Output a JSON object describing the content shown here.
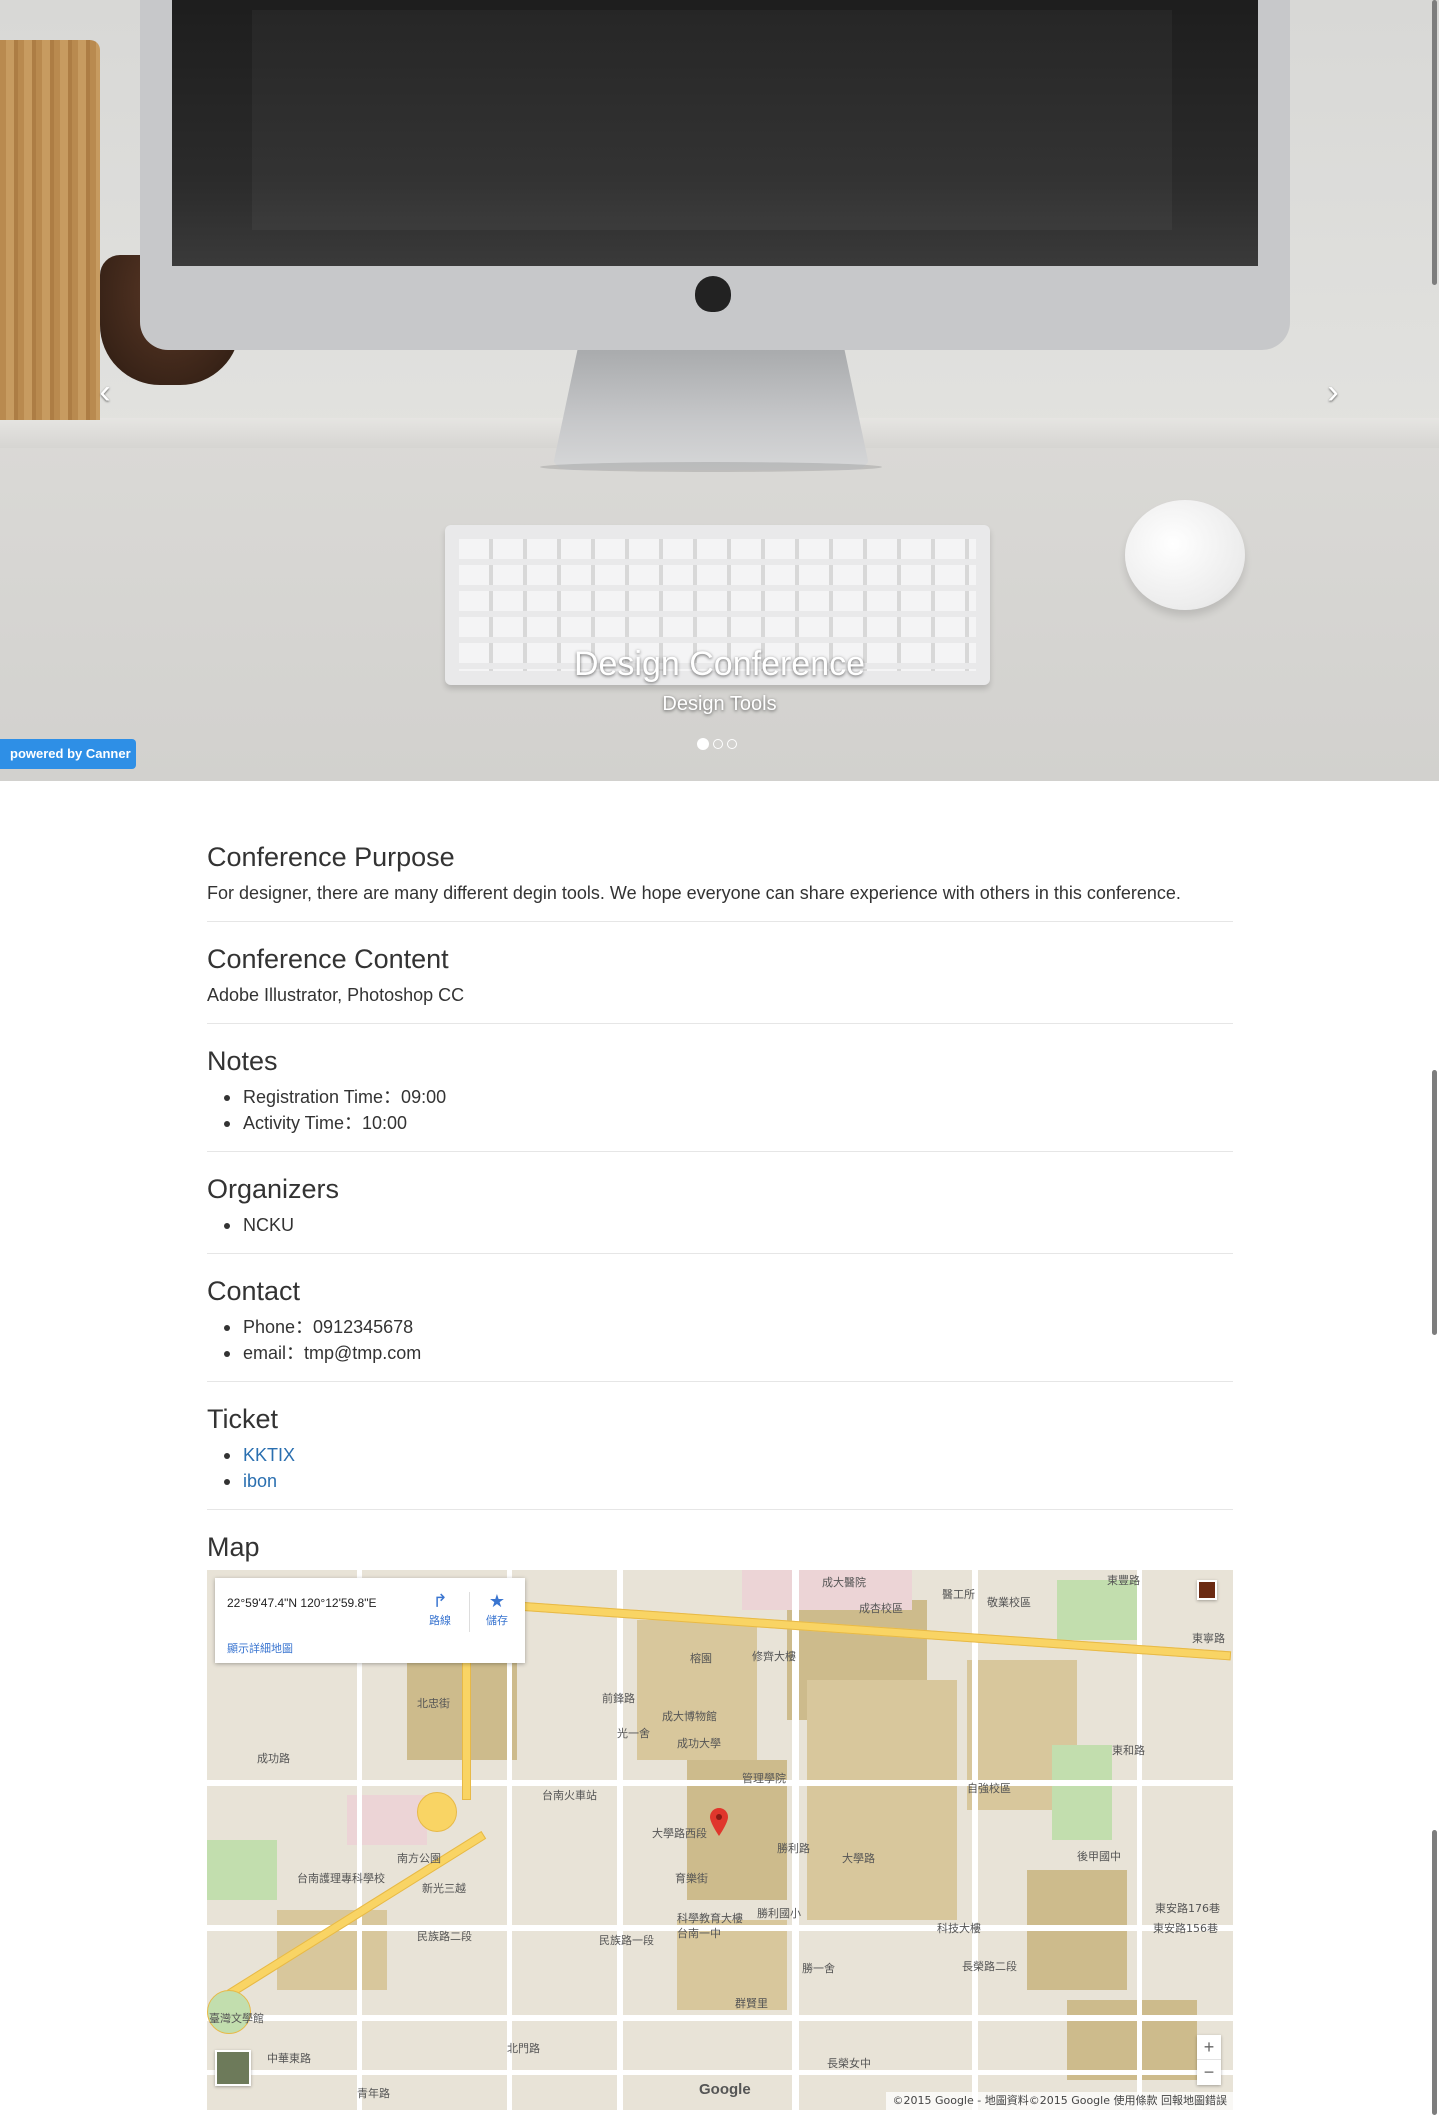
{
  "hero": {
    "title": "Design Conference",
    "subtitle": "Design Tools",
    "prev_icon": "chevron-left-icon",
    "next_icon": "chevron-right-icon",
    "prev_glyph": "‹",
    "next_glyph": "›",
    "slides": 3,
    "active_slide": 1
  },
  "badge": {
    "label": "powered by Canner",
    "color": "#2e8fe6"
  },
  "sections": {
    "purpose": {
      "title": "Conference Purpose",
      "text": "For designer, there are many different degin tools. We hope everyone can share experience with others in this conference."
    },
    "content": {
      "title": "Conference Content",
      "text": "Adobe Illustrator, Photoshop CC"
    },
    "notes": {
      "title": "Notes",
      "items": [
        "Registration Time：09:00",
        "Activity Time：10:00"
      ]
    },
    "organizers": {
      "title": "Organizers",
      "items": [
        "NCKU"
      ]
    },
    "contact": {
      "title": "Contact",
      "items": [
        "Phone：0912345678",
        "email：tmp@tmp.com"
      ]
    },
    "ticket": {
      "title": "Ticket",
      "links": [
        "KKTIX",
        "ibon"
      ],
      "link_color": "#2a6fb0"
    },
    "map": {
      "title": "Map"
    }
  },
  "map": {
    "coords": "22°59'47.4\"N 120°12'59.8\"E",
    "larger_map_link": "顯示詳細地圖",
    "directions_label": "路線",
    "save_label": "儲存",
    "zoom_in": "+",
    "zoom_out": "−",
    "google_logo": "Google",
    "attribution": "©2015 Google - 地圖資料©2015 Google   使用條款   回報地圖錯誤",
    "labels": [
      "成大醫院",
      "醫工所",
      "成杏校區",
      "敬業校區",
      "東豐路",
      "修齊大樓",
      "榕園",
      "成功大學",
      "成大博物館",
      "光一舍",
      "管理學院",
      "台南火車站",
      "前鋒路",
      "大學路西段",
      "育樂街",
      "勝利路",
      "自強校區",
      "東和路",
      "北忠街",
      "成功路",
      "南方公園",
      "民族路二段",
      "民族路一段",
      "台南護理專科學校",
      "新光三越",
      "科學教育大樓",
      "勝利國小",
      "大學路",
      "長榮路二段",
      "長榮女中",
      "後甲國中",
      "東安路176巷",
      "東安路156巷",
      "東寧路",
      "青年路",
      "台南一中",
      "臺灣文學館",
      "群賢里",
      "勝一舍",
      "科技大樓",
      "中華東路",
      "北門路"
    ]
  }
}
